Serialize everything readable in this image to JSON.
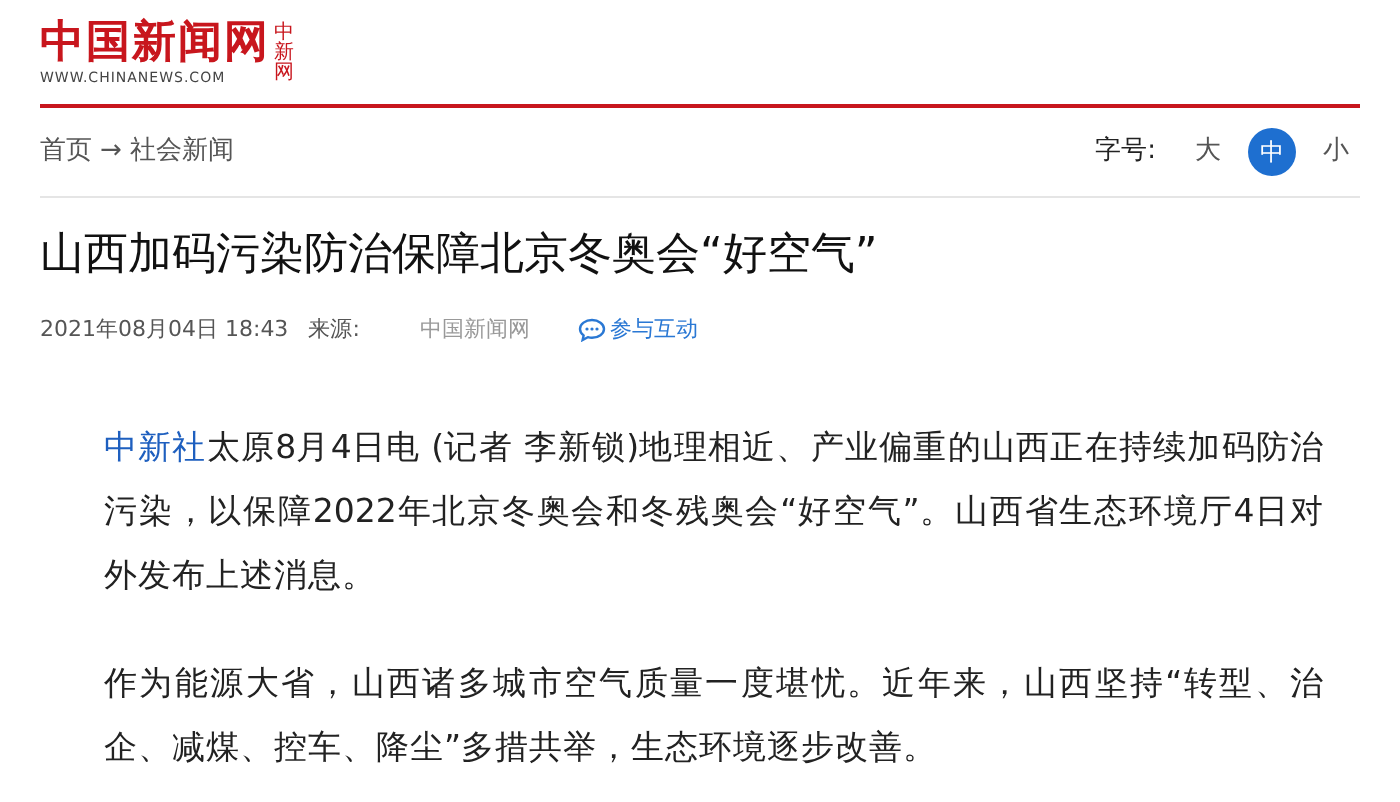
{
  "header": {
    "logo_text": "中国新闻网",
    "logo_badge": "中新网",
    "logo_url": "WWW.CHINANEWS.COM"
  },
  "breadcrumb": [
    "首页",
    "→",
    "社会新闻"
  ],
  "font_size": {
    "label": "字号:",
    "options": [
      {
        "label": "大",
        "selected": false
      },
      {
        "label": "中",
        "selected": true
      },
      {
        "label": "小",
        "selected": false
      }
    ]
  },
  "article": {
    "title": "山西加码污染防治保障北京冬奥会“好空气”",
    "date": "2021年08月04日 18:43",
    "source_label": "来源:",
    "source": "中国新闻网",
    "interact": "参与互动",
    "paragraphs": [
      {
        "lead": "中新社",
        "text": "太原8月4日电 (记者 李新锁)地理相近、产业偏重的山西正在持续加码防治污染，以保障2022年北京冬奥会和冬残奥会“好空气”。山西省生态环境厅4日对外发布上述消息。"
      },
      {
        "text": "作为能源大省，山西诸多城市空气质量一度堪忧。近年来，山西坚持“转型、治企、减煤、控车、降尘”多措共举，生态环境逐步改善。"
      }
    ]
  }
}
